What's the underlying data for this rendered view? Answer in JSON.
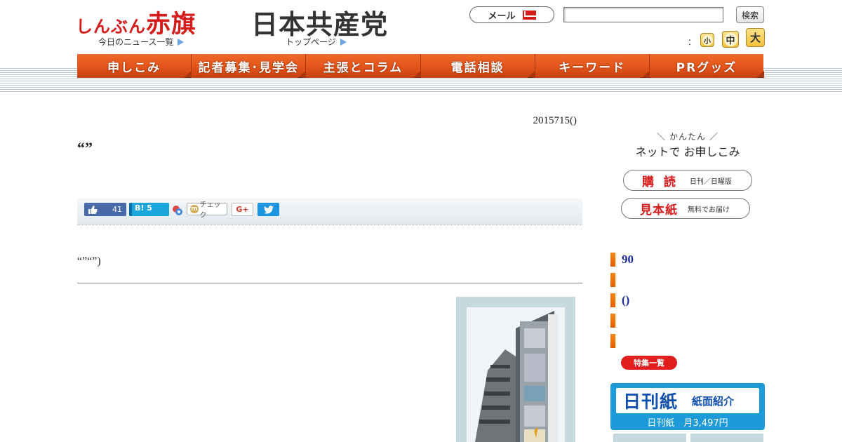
{
  "header": {
    "akahata_logo_small": "しんぶん",
    "akahata_logo_big": "赤旗",
    "news_list_link": "今日のニュース一覧",
    "jcp_logo": "日本共産党",
    "top_page_link": "トップページ",
    "mail_label": "メール",
    "search_placeholder": "",
    "search_button": "検索",
    "font_size_colon": "：",
    "font_small": "小",
    "font_medium": "中",
    "font_large": "大"
  },
  "nav": {
    "items": [
      "申しこみ",
      "記者募集･見学会",
      "主張とコラム",
      "電話相談",
      "キーワード",
      "PRグッズ"
    ]
  },
  "article": {
    "date": "2015715()",
    "title": "“”",
    "lead": "“”“”)",
    "social": {
      "fb_count": "41",
      "hatena_label": "B!",
      "hatena_count": "5",
      "mixi_check": "チェック",
      "gplus_label": "G+"
    }
  },
  "sidebar": {
    "kantan": "かんたん",
    "net_apply": "ネットで お申しこみ",
    "subscribe_big": "購 読",
    "subscribe_small": "日刊／日曜版",
    "sample_big": "見本紙",
    "sample_small": "無料でお届け",
    "features": [
      "90",
      "",
      "()",
      "",
      ""
    ],
    "features_list_button": "特集一覧",
    "nikkan_title": "日刊紙",
    "nikkan_intro": "紙面紹介",
    "nikkan_price": "日刊紙　月3,497円"
  },
  "colors": {
    "brand_red": "#d61b1b",
    "nav_orange": "#e4561c",
    "link_blue": "#1a2aa0",
    "nikkan_blue": "#1d9ad8"
  }
}
